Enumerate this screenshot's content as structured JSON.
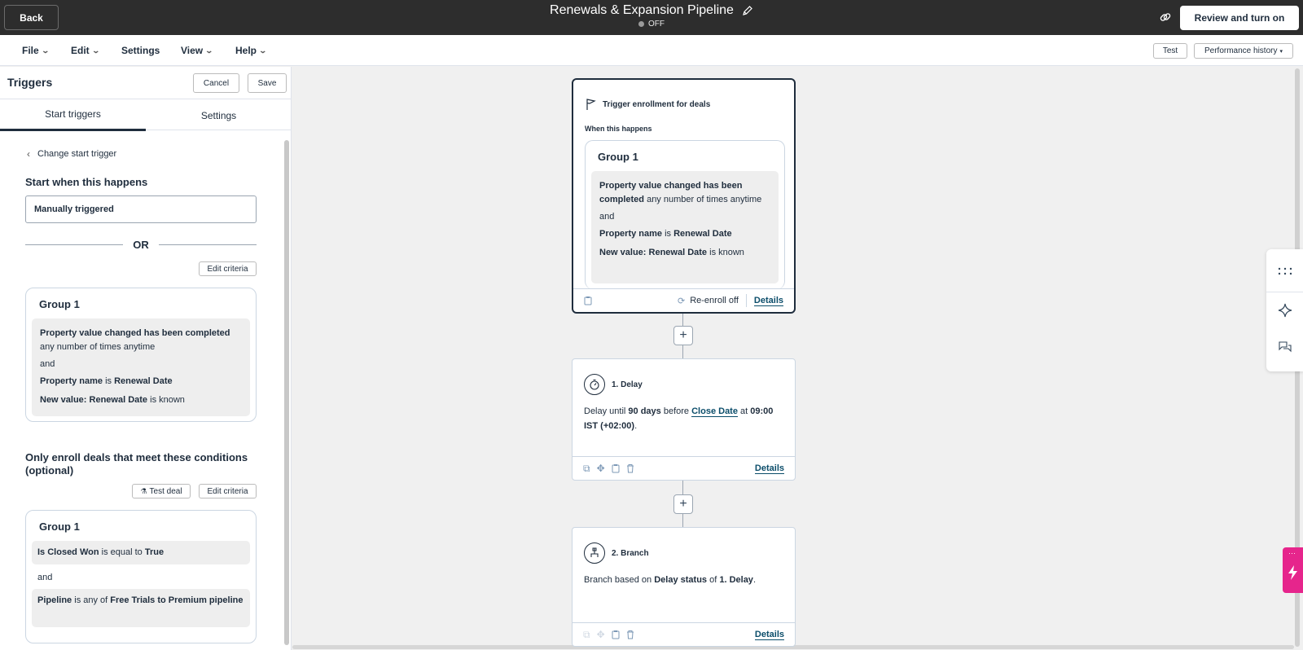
{
  "topbar": {
    "back_label": "Back",
    "title": "Renewals & Expansion Pipeline",
    "status": "OFF",
    "review_label": "Review and turn on",
    "icons": [
      "pencil-icon",
      "link-icon"
    ]
  },
  "menubar": {
    "items": [
      "File",
      "Edit",
      "Settings",
      "View",
      "Help"
    ],
    "test_label": "Test",
    "performance_label": "Performance history"
  },
  "panel": {
    "title": "Triggers",
    "cancel_label": "Cancel",
    "save_label": "Save",
    "tabs": [
      "Start triggers",
      "Settings"
    ],
    "change_trigger": "Change start trigger",
    "start_heading": "Start when this happens",
    "trigger_value": "Manually triggered",
    "or_label": "OR",
    "edit_criteria_label": "Edit criteria",
    "group1": {
      "title": "Group 1",
      "c1_bold": "Property value changed has been completed",
      "c1_rest": " any number of times anytime",
      "and": "and",
      "c2_bold1": "Property name",
      "c2_mid": " is ",
      "c2_bold2": "Renewal Date",
      "c3_bold": "New value: Renewal Date",
      "c3_rest": " is known"
    },
    "enroll_heading": "Only enroll deals that meet these conditions (optional)",
    "test_deal_label": "Test deal",
    "edit_criteria_label2": "Edit criteria",
    "group2": {
      "title": "Group 1",
      "c1_bold1": "Is Closed Won",
      "c1_mid": " is equal to ",
      "c1_bold2": "True",
      "and": "and",
      "c2_bold1": "Pipeline",
      "c2_mid": " is any of ",
      "c2_bold2": "Free Trials to Premium pipeline"
    }
  },
  "canvas": {
    "trigger_node": {
      "title": "Trigger enrollment for deals",
      "when": "When this happens",
      "group_title": "Group 1",
      "c1_bold": "Property value changed has been completed",
      "c1_rest": " any number of times anytime",
      "and": "and",
      "c2_bold1": "Property name",
      "c2_mid": " is ",
      "c2_bold2": "Renewal Date",
      "c3_bold": "New value: Renewal Date",
      "c3_rest": " is known",
      "reenroll": "Re-enroll off",
      "details": "Details"
    },
    "delay_node": {
      "title": "1. Delay",
      "t1": "Delay until ",
      "b1": "90 days",
      "t2": " before ",
      "link": "Close Date",
      "t3": " at ",
      "b2": "09:00 IST (+02:00)",
      "t4": ".",
      "details": "Details"
    },
    "branch_node": {
      "title": "2. Branch",
      "t1": "Branch based on ",
      "b1": "Delay status",
      "t2": " of ",
      "b2": "1. Delay",
      "t3": ".",
      "details": "Details"
    }
  }
}
